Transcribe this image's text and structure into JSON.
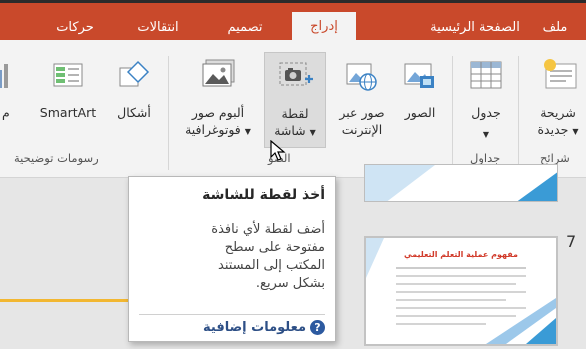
{
  "tabs": {
    "file": "ملف",
    "home": "الصفحة الرئيسية",
    "insert": "إدراج",
    "design": "تصميم",
    "transitions": "انتقالات",
    "animations": "حركات"
  },
  "ribbon": {
    "new_slide": [
      "شريحة",
      "جديدة"
    ],
    "table": "جدول",
    "pictures": "الصور",
    "online_pictures": [
      "صور عبر",
      "الإنترنت"
    ],
    "screenshot": [
      "لقطة",
      "شاشة"
    ],
    "photo_album": [
      "ألبوم صور",
      "فوتوغرافية"
    ],
    "shapes": "أشكال",
    "smartart": "SmartArt",
    "chart_partial": "م",
    "groups": {
      "slides": "شرائح",
      "tables": "جداول",
      "images": "الصو",
      "illustrations": "رسومات توضيحية"
    }
  },
  "slides": {
    "next_number": "7",
    "thumb_title": "مفهوم عملية التعلم التعليمي"
  },
  "tooltip": {
    "title": "أخذ لقطة للشاشة",
    "body_lines": [
      "أضف لقطة لأي نافذة",
      "مفتوحة على سطح",
      "المكتب إلى المستند",
      "بشكل سريع."
    ],
    "more_info": "معلومات إضافية",
    "help_glyph": "?"
  },
  "colors": {
    "accent": "#c9492b",
    "callout": "#f2b731",
    "link": "#2d4f86"
  }
}
